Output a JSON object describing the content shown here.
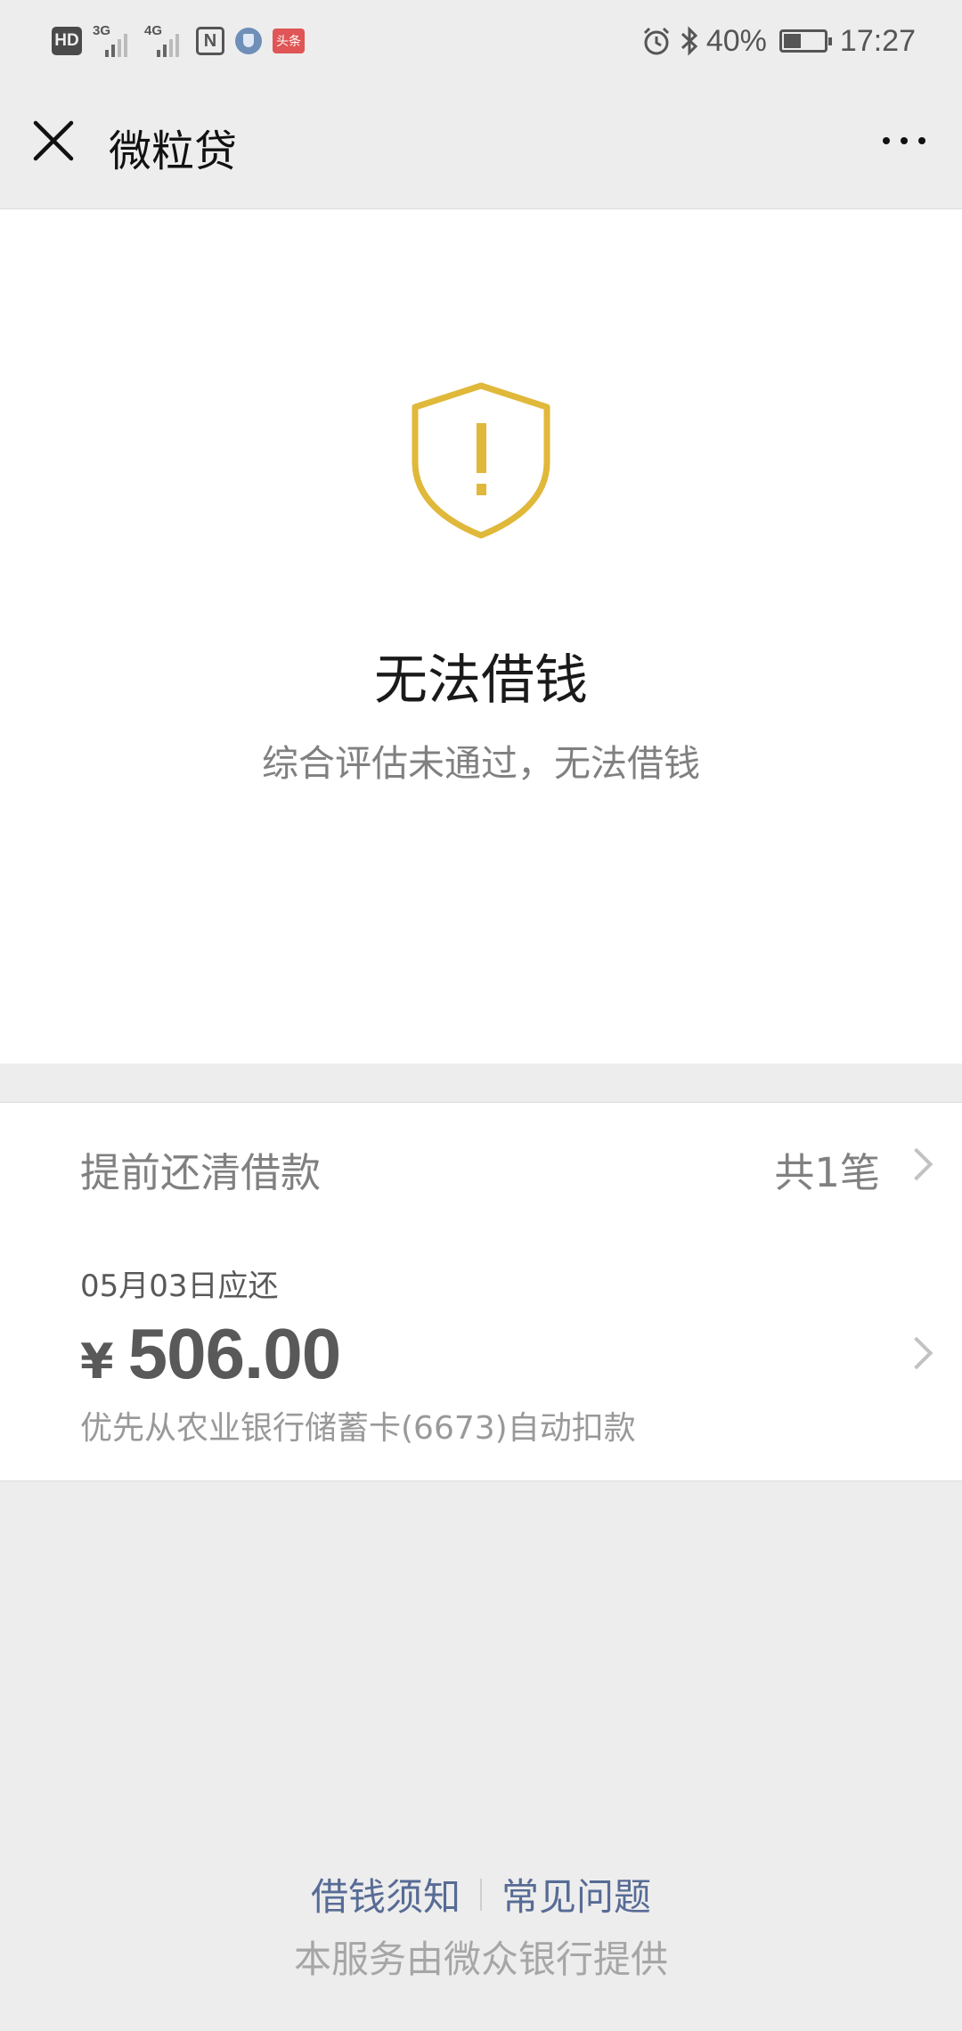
{
  "status_bar": {
    "hd": "HD",
    "net1": "3G",
    "net2": "4G",
    "nfc": "N",
    "toutiao": "头条",
    "battery_percent": "40%",
    "time": "17:27",
    "battery_level": 0.4
  },
  "nav": {
    "title": "微粒贷"
  },
  "result": {
    "title": "无法借钱",
    "description": "综合评估未通过，无法借钱",
    "icon_color": "#e0b83a"
  },
  "repay": {
    "label": "提前还清借款",
    "count": "共1笔"
  },
  "bill": {
    "due_date": "05月03日应还",
    "currency": "¥",
    "amount": "506.00",
    "note": "优先从农业银行储蓄卡(6673)自动扣款"
  },
  "footer": {
    "link_notice": "借钱须知",
    "link_faq": "常见问题",
    "provider": "本服务由微众银行提供"
  }
}
